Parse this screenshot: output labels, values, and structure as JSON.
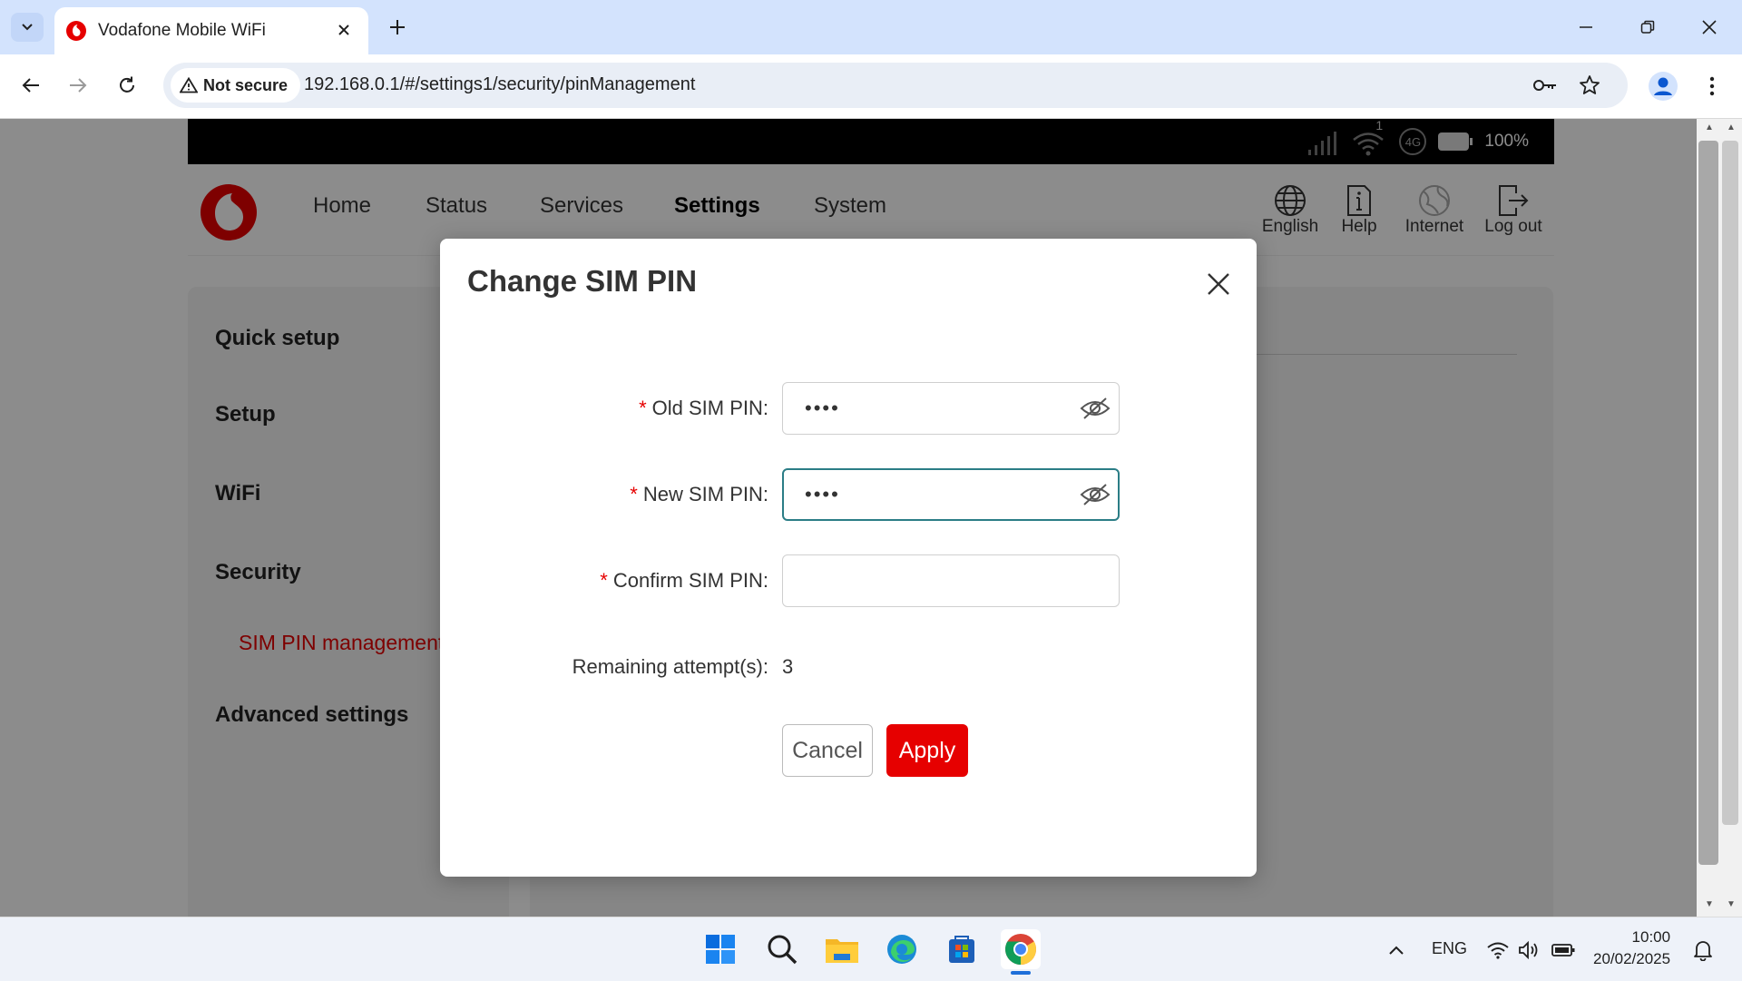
{
  "browser": {
    "tab_title": "Vodafone Mobile WiFi",
    "security_label": "Not secure",
    "url": "192.168.0.1/#/settings1/security/pinManagement"
  },
  "router": {
    "battery_percent": "100%",
    "network_type": "4G",
    "wifi_clients": "1",
    "nav": {
      "home": "Home",
      "status": "Status",
      "services": "Services",
      "settings": "Settings",
      "system": "System"
    },
    "utils": {
      "language": "English",
      "help": "Help",
      "internet": "Internet",
      "logout": "Log out"
    },
    "sidebar": {
      "quick_setup": "Quick setup",
      "setup": "Setup",
      "wifi": "WiFi",
      "security": "Security",
      "sim_pin": "SIM PIN management",
      "advanced": "Advanced settings"
    },
    "brand_color": "#e60000"
  },
  "dialog": {
    "title": "Change SIM PIN",
    "old_pin_label": "Old SIM PIN:",
    "old_pin_value": "••••",
    "new_pin_label": "New SIM PIN:",
    "new_pin_value": "••••",
    "confirm_pin_label": "Confirm SIM PIN:",
    "confirm_pin_value": "",
    "required_mark": "*",
    "remaining_label": "Remaining attempt(s):",
    "remaining_value": "3",
    "cancel_label": "Cancel",
    "apply_label": "Apply"
  },
  "taskbar": {
    "language": "ENG",
    "time": "10:00",
    "date": "20/02/2025"
  }
}
